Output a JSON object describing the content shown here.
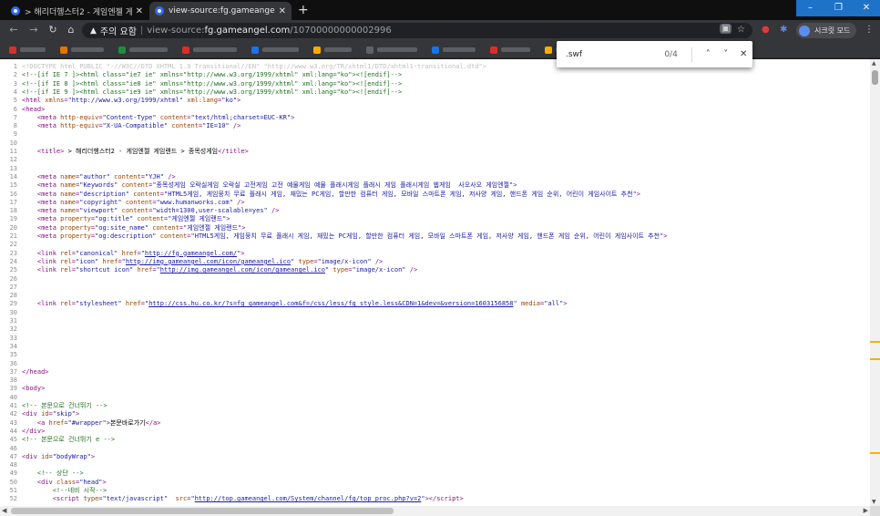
{
  "tabs": [
    {
      "title": "> 해리더헹스터2 - 게임엔젤 게",
      "close": "✕"
    },
    {
      "title": "view-source:fg.gameangel.com/",
      "close": "✕"
    }
  ],
  "new_tab": "+",
  "window_controls": {
    "minimize": "–",
    "maximize": "❐",
    "close": "✕"
  },
  "nav": {
    "back": "←",
    "forward": "→",
    "reload": "↻",
    "home": "⌂"
  },
  "omnibox": {
    "warning_icon": "▲",
    "security_label": "주의 요함",
    "separator": "|",
    "url_prefix": "view-source:",
    "url_host": "fg.gameangel.com",
    "url_path": "/10700000000002996"
  },
  "toolbar_icons": {
    "page_action": "▣",
    "star": "☆",
    "ext1": "●",
    "ext2": "✱",
    "menu": "⋮"
  },
  "incognito": {
    "label": "시크릿 모드"
  },
  "bookmarks": [
    {
      "color": "#d93025"
    },
    {
      "color": "#e37400"
    },
    {
      "color": "#1e8e3e"
    },
    {
      "color": "#d93025"
    },
    {
      "color": "#1a73e8"
    },
    {
      "color": "#f9ab00"
    },
    {
      "color": "#5f6368"
    },
    {
      "color": "#1a73e8"
    },
    {
      "color": "#d93025"
    },
    {
      "color": "#f9ab00"
    },
    {
      "color": "#f9ab00"
    },
    {
      "color": "#1e8e3e"
    }
  ],
  "find": {
    "query": ".swf",
    "count": "0/4",
    "prev": "˄",
    "next": "˅",
    "close": "✕"
  },
  "source_lines": [
    {
      "n": "1",
      "html": "<span class='c-doc'>&lt;!DOCTYPE html PUBLIC \"-//W3C//DTD XHTML 1.0 Transitional//EN\" \"http://www.w3.org/TR/xhtml1/DTD/xhtml1-transitional.dtd\"&gt;</span>"
    },
    {
      "n": "2",
      "html": "<span class='c-com'>&lt;!--[if IE 7 ]&gt;&lt;html class=\"ie7 ie\" xmlns=\"http://www.w3.org/1999/xhtml\" xml:lang=\"ko\"&gt;&lt;![endif]--&gt;</span>"
    },
    {
      "n": "3",
      "html": "<span class='c-com'>&lt;!--[if IE 8 ]&gt;&lt;html class=\"ie8 ie\" xmlns=\"http://www.w3.org/1999/xhtml\" xml:lang=\"ko\"&gt;&lt;![endif]--&gt;</span>"
    },
    {
      "n": "4",
      "html": "<span class='c-com'>&lt;!--[if IE 9 ]&gt;&lt;html class=\"ie9 ie\" xmlns=\"http://www.w3.org/1999/xhtml\" xml:lang=\"ko\"&gt;&lt;![endif]--&gt;</span>"
    },
    {
      "n": "5",
      "html": "<span class='c-tag'>&lt;html </span><span class='c-attr'>xmlns</span><span class='c-tag'>=</span><span class='c-val'>\"http://www.w3.org/1999/xhtml\"</span> <span class='c-attr'>xml:lang</span><span class='c-tag'>=</span><span class='c-val'>\"ko\"</span><span class='c-tag'>&gt;</span>"
    },
    {
      "n": "6",
      "html": "<span class='c-tag'>&lt;head&gt;</span>"
    },
    {
      "n": "7",
      "html": "    <span class='c-tag'>&lt;meta </span><span class='c-attr'>http-equiv</span><span class='c-tag'>=</span><span class='c-val'>\"Content-Type\"</span> <span class='c-attr'>content</span><span class='c-tag'>=</span><span class='c-val'>\"text/html;charset=EUC-KR\"</span><span class='c-tag'>&gt;</span>"
    },
    {
      "n": "8",
      "html": "    <span class='c-tag'>&lt;meta </span><span class='c-attr'>http-equiv</span><span class='c-tag'>=</span><span class='c-val'>\"X-UA-Compatible\"</span> <span class='c-attr'>content</span><span class='c-tag'>=</span><span class='c-val'>\"IE=10\"</span> <span class='c-tag'>/&gt;</span>"
    },
    {
      "n": "9",
      "html": ""
    },
    {
      "n": "10",
      "html": ""
    },
    {
      "n": "11",
      "html": "    <span class='c-tag'>&lt;title&gt;</span><span class='c-txt'> &gt; 해리더헹스터2 - 게임엔젤 게임랜드 &gt; 종목성게임</span><span class='c-tag'>&lt;/title&gt;</span>"
    },
    {
      "n": "12",
      "html": ""
    },
    {
      "n": "13",
      "html": ""
    },
    {
      "n": "14",
      "html": "    <span class='c-tag'>&lt;meta </span><span class='c-attr'>name</span><span class='c-tag'>=</span><span class='c-val'>\"author\"</span> <span class='c-attr'>content</span><span class='c-tag'>=</span><span class='c-val'>\"YJH\"</span> <span class='c-tag'>/&gt;</span>"
    },
    {
      "n": "15",
      "html": "    <span class='c-tag'>&lt;meta </span><span class='c-attr'>name</span><span class='c-tag'>=</span><span class='c-val'>\"Keywords\"</span> <span class='c-attr'>content</span><span class='c-tag'>=</span><span class='c-val'>\"종목성게임 오락실게임 오락실 고전게임 고전 예물게임 예물 플래시게임 플래시 게임 플래시게임 웹게임  사오사오 게임엔젤\"</span><span class='c-tag'>&gt;</span>"
    },
    {
      "n": "16",
      "html": "    <span class='c-tag'>&lt;meta </span><span class='c-attr'>name</span><span class='c-tag'>=</span><span class='c-val'>\"description\"</span> <span class='c-attr'>content</span><span class='c-tag'>=</span><span class='c-val'>\"HTML5게임, 게임뭉치 무료 플래시 게임, 재밌는 PC게임, 할만한 컴퓨터 게임, 모바일 스마트폰 게임, 저사양 게임, 핸드폰 게임 순위, 어린이 게임사이트 추천\"</span><span class='c-tag'>&gt;</span>"
    },
    {
      "n": "17",
      "html": "    <span class='c-tag'>&lt;meta </span><span class='c-attr'>name</span><span class='c-tag'>=</span><span class='c-val'>\"copyright\"</span> <span class='c-attr'>content</span><span class='c-tag'>=</span><span class='c-val'>\"www.humanworks.com\"</span> <span class='c-tag'>/&gt;</span>"
    },
    {
      "n": "18",
      "html": "    <span class='c-tag'>&lt;meta </span><span class='c-attr'>name</span><span class='c-tag'>=</span><span class='c-val'>\"viewport\"</span> <span class='c-attr'>content</span><span class='c-tag'>=</span><span class='c-val'>\"width=1300,user-scalable=yes\"</span> <span class='c-tag'>/&gt;</span>"
    },
    {
      "n": "19",
      "html": "    <span class='c-tag'>&lt;meta </span><span class='c-attr'>property</span><span class='c-tag'>=</span><span class='c-val'>\"og:title\"</span> <span class='c-attr'>content</span><span class='c-tag'>=</span><span class='c-val'>\"게임엔젤 게임랜드\"</span><span class='c-tag'>&gt;</span>"
    },
    {
      "n": "20",
      "html": "    <span class='c-tag'>&lt;meta </span><span class='c-attr'>property</span><span class='c-tag'>=</span><span class='c-val'>\"og:site_name\"</span> <span class='c-attr'>content</span><span class='c-tag'>=</span><span class='c-val'>\"게임엔젤 게임랜드\"</span><span class='c-tag'>&gt;</span>"
    },
    {
      "n": "21",
      "html": "    <span class='c-tag'>&lt;meta </span><span class='c-attr'>property</span><span class='c-tag'>=</span><span class='c-val'>\"og:description\"</span> <span class='c-attr'>content</span><span class='c-tag'>=</span><span class='c-val'>\"HTML5게임, 게임뭉치 무료 플래시 게임, 재밌는 PC게임, 할만한 컴퓨터 게임, 모바일 스마트폰 게임, 저사양 게임, 핸드폰 게임 순위, 어린이 게임사이트 추천\"</span><span class='c-tag'>&gt;</span>"
    },
    {
      "n": "22",
      "html": ""
    },
    {
      "n": "23",
      "html": "    <span class='c-tag'>&lt;link </span><span class='c-attr'>rel</span><span class='c-tag'>=</span><span class='c-val'>\"canonical\"</span> <span class='c-attr'>href</span><span class='c-tag'>=</span><span class='c-val'>\"<span class='c-link'>http://fg.gameangel.com/</span>\"</span><span class='c-tag'>&gt;</span>"
    },
    {
      "n": "24",
      "html": "    <span class='c-tag'>&lt;link </span><span class='c-attr'>rel</span><span class='c-tag'>=</span><span class='c-val'>\"icon\"</span> <span class='c-attr'>href</span><span class='c-tag'>=</span><span class='c-val'>\"<span class='c-link'>http://img.gameangel.com/icon/gameangel.ico</span>\"</span> <span class='c-attr'>type</span><span class='c-tag'>=</span><span class='c-val'>\"image/x-icon\"</span> <span class='c-tag'>/&gt;</span>"
    },
    {
      "n": "25",
      "html": "    <span class='c-tag'>&lt;link </span><span class='c-attr'>rel</span><span class='c-tag'>=</span><span class='c-val'>\"shortcut icon\"</span> <span class='c-attr'>href</span><span class='c-tag'>=</span><span class='c-val'>\"<span class='c-link'>http://img.gameangel.com/icon/gameangel.ico</span>\"</span> <span class='c-attr'>type</span><span class='c-tag'>=</span><span class='c-val'>\"image/x-icon\"</span> <span class='c-tag'>/&gt;</span>"
    },
    {
      "n": "26",
      "html": ""
    },
    {
      "n": "27",
      "html": ""
    },
    {
      "n": "28",
      "html": ""
    },
    {
      "n": "29",
      "html": "    <span class='c-tag'>&lt;link </span><span class='c-attr'>rel</span><span class='c-tag'>=</span><span class='c-val'>\"stylesheet\"</span> <span class='c-attr'>href</span><span class='c-tag'>=</span><span class='c-val'>\"<span class='c-link'>http://css.hu.co.kr/?s=fg_gameangel.com&amp;f=/css/less/fg_style.less&amp;CDN=1&amp;dev=&amp;version=1603156858</span>\"</span> <span class='c-attr'>media</span><span class='c-tag'>=</span><span class='c-val'>\"all\"</span><span class='c-tag'>&gt;</span>"
    },
    {
      "n": "30",
      "html": ""
    },
    {
      "n": "31",
      "html": ""
    },
    {
      "n": "32",
      "html": ""
    },
    {
      "n": "33",
      "html": ""
    },
    {
      "n": "34",
      "html": ""
    },
    {
      "n": "35",
      "html": ""
    },
    {
      "n": "36",
      "html": ""
    },
    {
      "n": "37",
      "html": "<span class='c-tag'>&lt;/head&gt;</span>"
    },
    {
      "n": "38",
      "html": ""
    },
    {
      "n": "39",
      "html": "<span class='c-tag'>&lt;body&gt;</span>"
    },
    {
      "n": "40",
      "html": ""
    },
    {
      "n": "41",
      "html": "<span class='c-com'>&lt;!-- 본문으로 건너뛰기 --&gt;</span>"
    },
    {
      "n": "42",
      "html": "<span class='c-tag'>&lt;div </span><span class='c-attr'>id</span><span class='c-tag'>=</span><span class='c-val'>\"skip\"</span><span class='c-tag'>&gt;</span>"
    },
    {
      "n": "43",
      "html": "    <span class='c-tag'>&lt;a </span><span class='c-attr'>href</span><span class='c-tag'>=</span><span class='c-val'>\"#wrapper\"</span><span class='c-tag'>&gt;</span><span class='c-txt'>본문바로가기</span><span class='c-tag'>&lt;/a&gt;</span>"
    },
    {
      "n": "44",
      "html": "<span class='c-tag'>&lt;/div&gt;</span>"
    },
    {
      "n": "45",
      "html": "<span class='c-com'>&lt;!-- 본문으로 건너뛰기 e --&gt;</span>"
    },
    {
      "n": "46",
      "html": ""
    },
    {
      "n": "47",
      "html": "<span class='c-tag'>&lt;div </span><span class='c-attr'>id</span><span class='c-tag'>=</span><span class='c-val'>\"bodyWrap\"</span><span class='c-tag'>&gt;</span>"
    },
    {
      "n": "48",
      "html": ""
    },
    {
      "n": "49",
      "html": "    <span class='c-com'>&lt;!-- 상단 --&gt;</span>"
    },
    {
      "n": "50",
      "html": "    <span class='c-tag'>&lt;div </span><span class='c-attr'>class</span><span class='c-tag'>=</span><span class='c-val'>\"head\"</span><span class='c-tag'>&gt;</span>"
    },
    {
      "n": "51",
      "html": "        <span class='c-com'>&lt;!--네비 시작--&gt;</span>"
    },
    {
      "n": "52",
      "html": "        <span class='c-tag'>&lt;script </span><span class='c-attr'>type</span><span class='c-tag'>=</span><span class='c-val'>\"text/javascript\"</span>  <span class='c-attr'>src</span><span class='c-tag'>=</span><span class='c-val'>\"<span class='c-link'>http://top.gameangel.com/System/channel/fg/top_proc.php?v=2</span>\"</span><span class='c-tag'>&gt;&lt;/script&gt;</span>"
    }
  ],
  "scroll_marks": [
    0.63,
    0.67,
    0.88
  ]
}
